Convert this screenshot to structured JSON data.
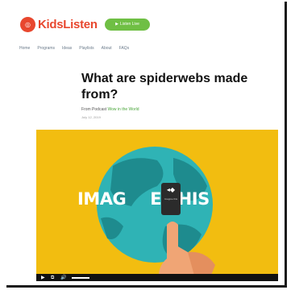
{
  "brand": {
    "name": "KidsListen",
    "accent": "#e8472e"
  },
  "header": {
    "listen_button": "Listen Live",
    "button_color": "#6fbf44"
  },
  "nav": {
    "items": [
      "Home",
      "Programs",
      "Ideas",
      "Playlists",
      "About",
      "FAQs"
    ]
  },
  "article": {
    "title": "What are spiderwebs made from?",
    "byline_prefix": "From Podcast",
    "byline_link": "Wow in the World",
    "date": "July 12, 2019"
  },
  "video": {
    "headline_left": "IMAG",
    "headline_right": "E THIS",
    "phone_text": "Imagine this",
    "background": "#f2bd10",
    "controls": {
      "play_icon": "▶",
      "captions_icon": "⧉",
      "volume_icon": "🔊"
    }
  }
}
